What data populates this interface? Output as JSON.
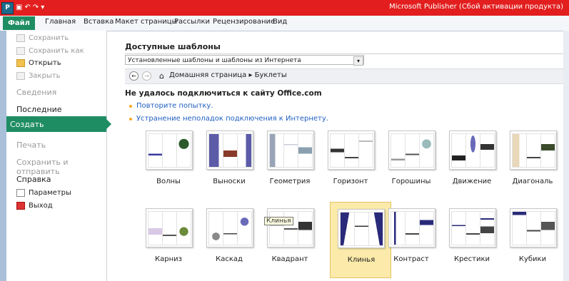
{
  "window": {
    "title": "Microsoft Publisher (Сбой активации продукта)",
    "app_logo_letter": "P"
  },
  "ribbon": {
    "tabs": [
      "Файл",
      "Главная",
      "Вставка",
      "Макет страницы",
      "Рассылки",
      "Рецензирование",
      "Вид"
    ]
  },
  "sidebar": {
    "commands": [
      {
        "label": "Сохранить",
        "enabled": false
      },
      {
        "label": "Сохранить как",
        "enabled": false
      },
      {
        "label": "Открыть",
        "enabled": true
      },
      {
        "label": "Закрыть",
        "enabled": false
      }
    ],
    "sections": [
      {
        "label": "Сведения",
        "enabled": false
      },
      {
        "label": "Последние",
        "enabled": true
      },
      {
        "label": "Создать",
        "enabled": true,
        "selected": true
      },
      {
        "label": "Печать",
        "enabled": false
      },
      {
        "label": "Сохранить и отправить",
        "enabled": false
      },
      {
        "label": "Справка",
        "enabled": true
      }
    ],
    "bottom_commands": [
      {
        "label": "Параметры"
      },
      {
        "label": "Выход"
      }
    ]
  },
  "main": {
    "heading": "Доступные шаблоны",
    "dropdown_value": "Установленные шаблоны и шаблоны из Интернета",
    "breadcrumb": "Домашняя страница ▸ Буклеты",
    "error_title": "Не удалось подключиться к сайту Office.com",
    "links": [
      "Повторите попытку.",
      "Устранение неполадок подключения к Интернету."
    ],
    "templates_row1": [
      "Волны",
      "Выноски",
      "Геометрия",
      "Горизонт",
      "Горошины",
      "Движение",
      "Диагональ"
    ],
    "templates_row2": [
      "Карниз",
      "Каскад",
      "Квадрант",
      "Клинья",
      "Контраст",
      "Крестики",
      "Кубики"
    ],
    "selected_template": "Клинья",
    "tooltip": "Клинья"
  },
  "colors": {
    "titlebar": "#e21e1e",
    "accent": "#1f8d63",
    "selection": "#fbeaa9",
    "link": "#1f5fbf"
  }
}
